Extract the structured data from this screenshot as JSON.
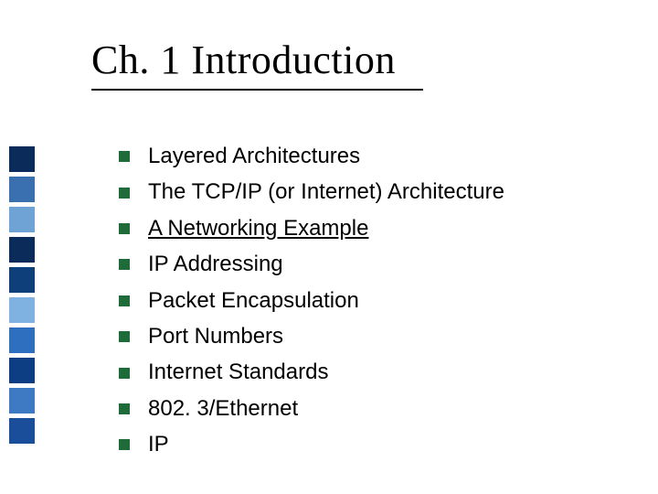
{
  "title": "Ch. 1 Introduction",
  "bullets": [
    {
      "text": "Layered Architectures",
      "link": false
    },
    {
      "text": "The TCP/IP (or Internet) Architecture",
      "link": false
    },
    {
      "text": "A Networking Example",
      "link": true
    },
    {
      "text": "IP Addressing",
      "link": false
    },
    {
      "text": "Packet Encapsulation",
      "link": false
    },
    {
      "text": "Port Numbers",
      "link": false
    },
    {
      "text": "Internet Standards",
      "link": false
    },
    {
      "text": "802. 3/Ethernet",
      "link": false
    },
    {
      "text": "IP",
      "link": false
    }
  ],
  "deco_colors": [
    "#0b2b5a",
    "#3a6fb0",
    "#6fa3d6",
    "#0b2b5a",
    "#0f3f7a",
    "#7fb2e0",
    "#2e6fc0",
    "#0d3e84",
    "#3e79c4",
    "#1a4e9a"
  ]
}
